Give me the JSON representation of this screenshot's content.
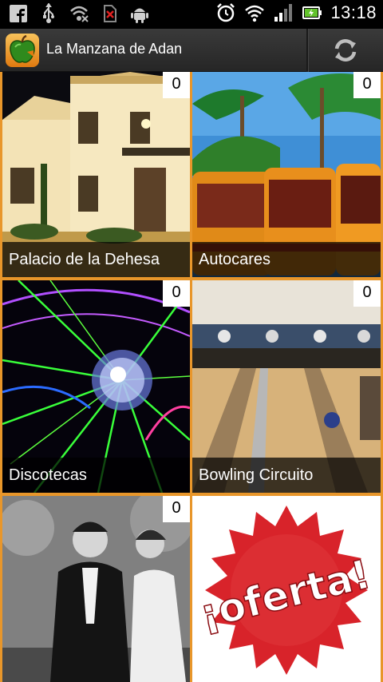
{
  "status_bar": {
    "time": "13:18",
    "left_icons": [
      "facebook-icon",
      "usb-icon",
      "no-signal-icon",
      "no-sim-icon",
      "android-icon"
    ],
    "right_icons": [
      "alarm-icon",
      "wifi-icon",
      "signal-icon",
      "battery-icon"
    ]
  },
  "action_bar": {
    "title": "La Manzana de Adan",
    "refresh_icon": "refresh-icon"
  },
  "tiles": [
    {
      "label": "Palacio de la Dehesa",
      "count": "0"
    },
    {
      "label": "Autocares",
      "count": "0"
    },
    {
      "label": "Discotecas",
      "count": "0"
    },
    {
      "label": "Bowling Circuito",
      "count": "0"
    },
    {
      "label": "",
      "count": "0"
    },
    {
      "label": "",
      "count": ""
    }
  ],
  "offer_banner": {
    "text": "¡oferta!"
  },
  "colors": {
    "grid_border": "#e8962a",
    "action_bar": "#2e2e2e",
    "offer_red": "#d8232a"
  }
}
